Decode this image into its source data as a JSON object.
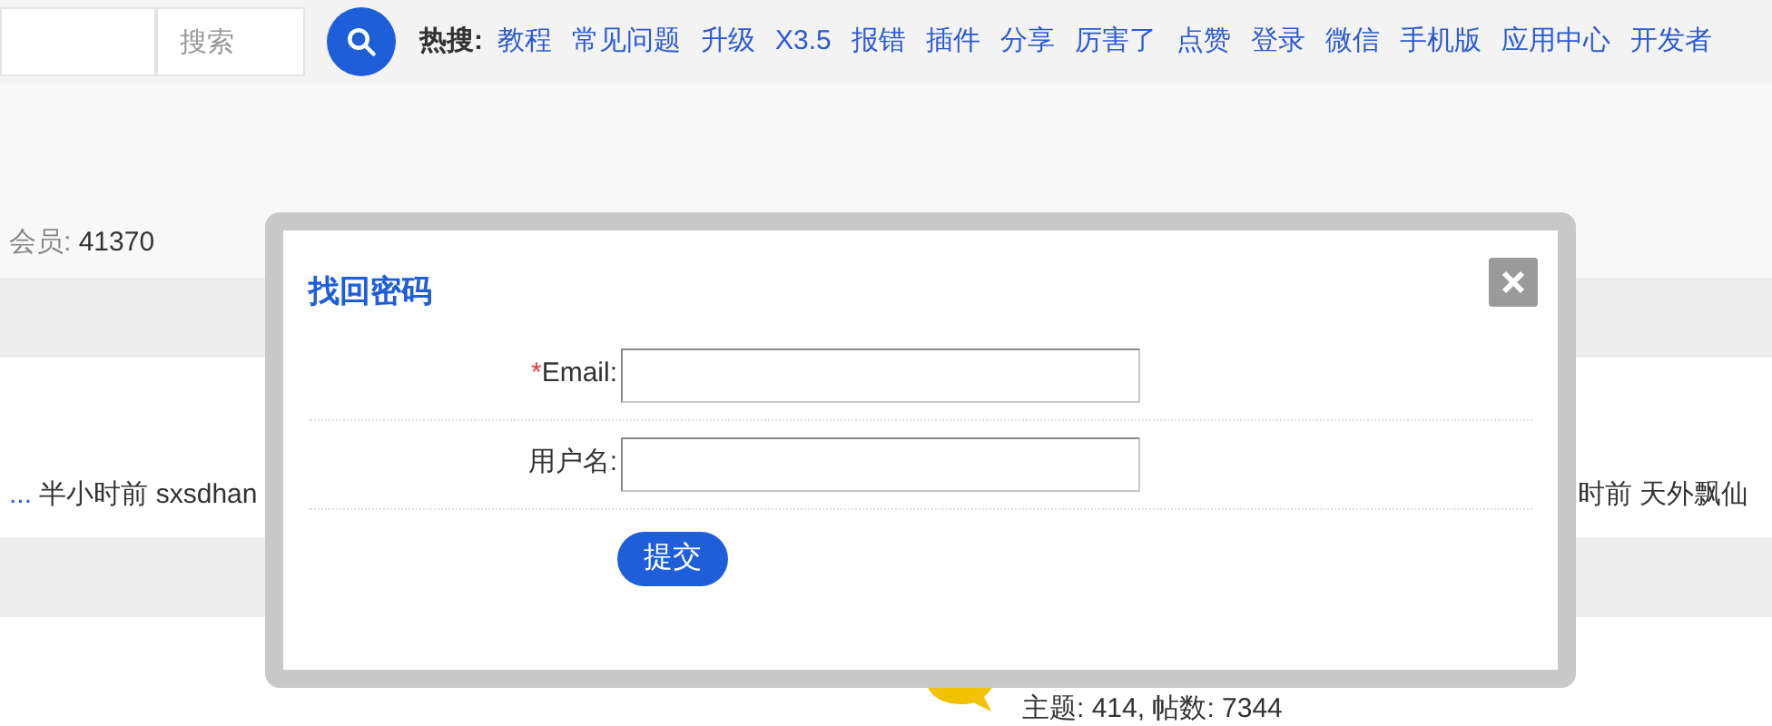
{
  "header": {
    "search": {
      "placeholder": "搜索"
    },
    "hot_label": "热搜:",
    "hot_links": [
      "教程",
      "常见问题",
      "升级",
      "X3.5",
      "报错",
      "插件",
      "分享",
      "厉害了",
      "点赞",
      "登录",
      "微信",
      "手机版",
      "应用中心",
      "开发者"
    ]
  },
  "stats": {
    "label": "会员:",
    "value": "41370"
  },
  "row_left": {
    "ellipsis": "...",
    "text": "半小时前 sxsdhan"
  },
  "row_right": {
    "text": "时前 天外飘仙"
  },
  "forum": {
    "counts": "主题: 414, 帖数: 7344"
  },
  "dialog": {
    "title": "找回密码",
    "fields": [
      {
        "label": "Email:",
        "required": true
      },
      {
        "label": "用户名:",
        "required": false
      }
    ],
    "required_mark": "*",
    "submit": "提交"
  }
}
